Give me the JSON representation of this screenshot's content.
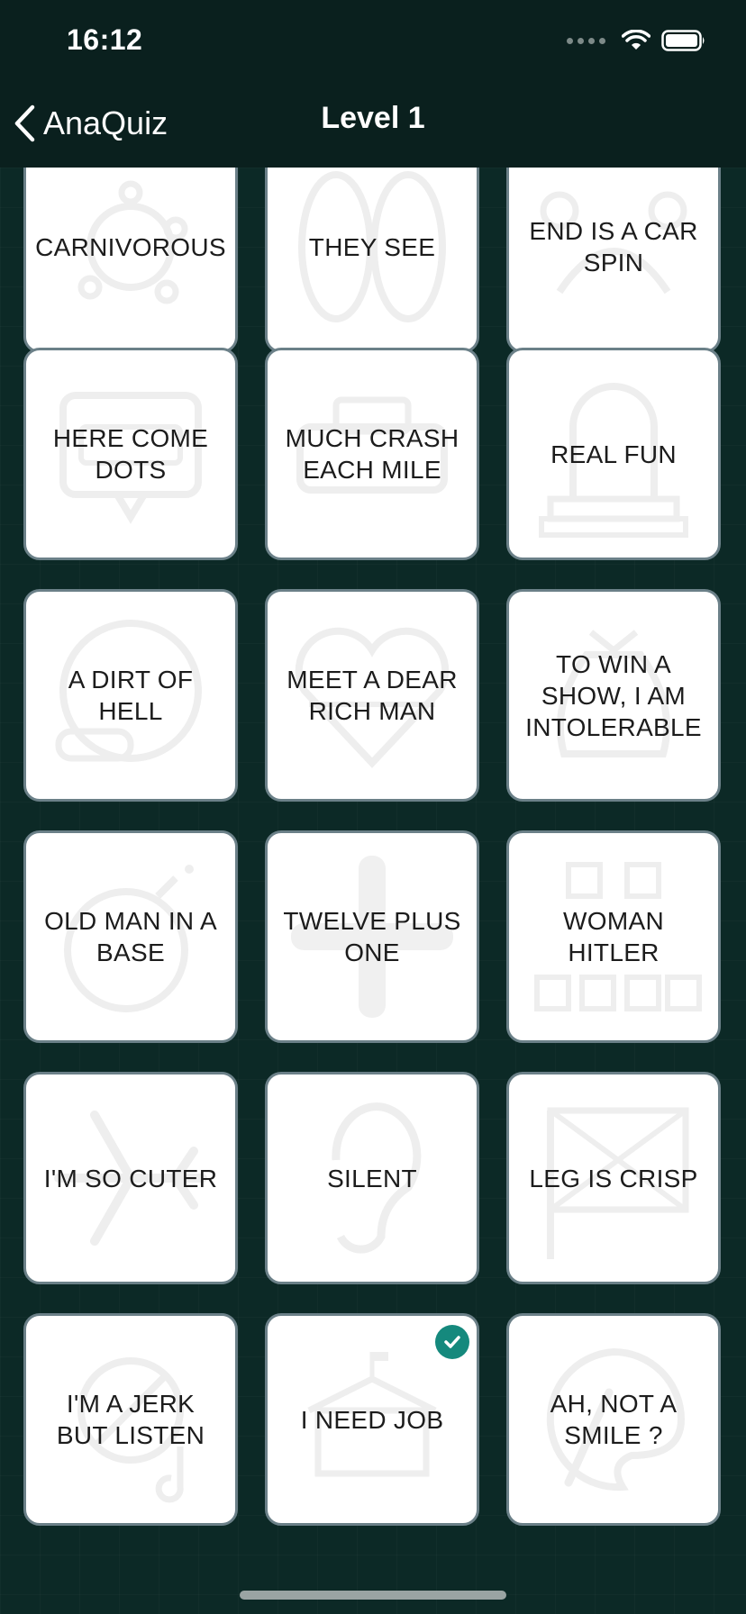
{
  "status_bar": {
    "time": "16:12"
  },
  "nav": {
    "back_label": "AnaQuiz",
    "title": "Level 1"
  },
  "tiles": [
    {
      "label": "CARNIVOROUS",
      "icon": "virus-icon"
    },
    {
      "label": "THEY SEE",
      "icon": "eyes-icon"
    },
    {
      "label": "END IS A CAR SPIN",
      "icon": "crab-icon"
    },
    {
      "label": "HERE COME DOTS",
      "icon": "chat-bubble-icon"
    },
    {
      "label": "MUCH CRASH EACH MILE",
      "icon": "car-crash-icon"
    },
    {
      "label": "REAL FUN",
      "icon": "tombstone-icon"
    },
    {
      "label": "A DIRT OF HELL",
      "icon": "globe-tank-icon"
    },
    {
      "label": "MEET A DEAR RICH MAN",
      "icon": "heart-flag-icon"
    },
    {
      "label": "TO WIN A SHOW, I AM INTOLERABLE",
      "icon": "money-bag-icon"
    },
    {
      "label": "OLD MAN IN A BASE",
      "icon": "bomb-icon"
    },
    {
      "label": "TWELVE PLUS ONE",
      "icon": "plus-icon"
    },
    {
      "label": "WOMAN HITLER",
      "icon": "org-chart-icon"
    },
    {
      "label": "I'M SO CUTER",
      "icon": "airplane-icon"
    },
    {
      "label": "SILENT",
      "icon": "ear-icon"
    },
    {
      "label": "LEG IS CRISP",
      "icon": "uk-flag-icon"
    },
    {
      "label": "I'M A JERK BUT LISTEN",
      "icon": "no-music-icon"
    },
    {
      "label": "I NEED JOB",
      "icon": "white-house-icon",
      "solved": true
    },
    {
      "label": "AH, NOT A SMILE ?",
      "icon": "palette-icon"
    }
  ],
  "colors": {
    "background": "#0c2926",
    "bar": "#0a201e",
    "tile_border": "#6b8088",
    "check": "#15897d"
  }
}
